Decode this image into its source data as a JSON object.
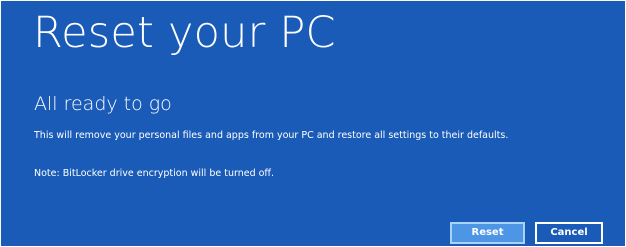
{
  "window": {
    "title": "Reset your PC"
  },
  "content": {
    "subtitle": "All ready to go",
    "description": "This will remove your personal files and apps from your PC and restore all settings to their defaults.",
    "note": "Note: BitLocker drive encryption will be turned off."
  },
  "buttons": {
    "reset_label": "Reset",
    "cancel_label": "Cancel"
  },
  "colors": {
    "background": "#1a5bb8",
    "primary_button": "#4d96e6",
    "text": "#ffffff"
  }
}
